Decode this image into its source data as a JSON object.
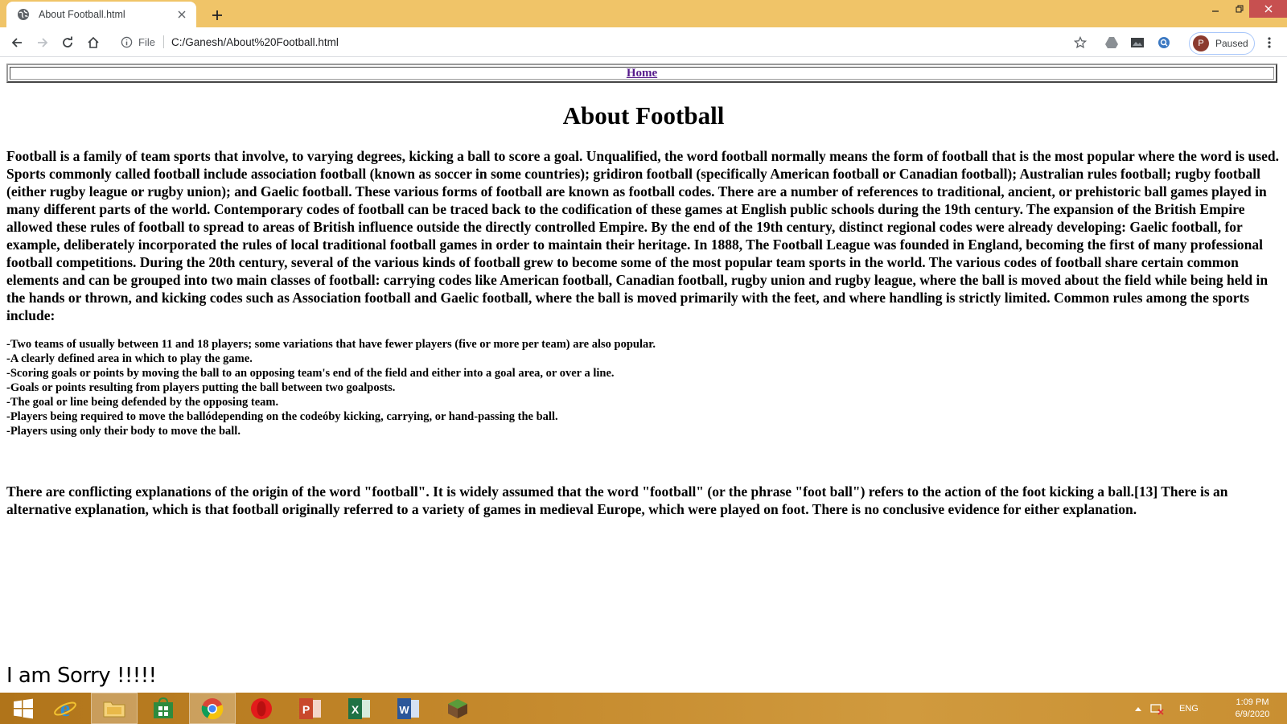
{
  "browser": {
    "tab_title": "About Football.html",
    "site_label": "File",
    "url": "C:/Ganesh/About%20Football.html",
    "profile_initial": "P",
    "profile_status": "Paused"
  },
  "page": {
    "nav_link": "Home",
    "title": "About Football",
    "paragraph1": "Football is a family of team sports that involve, to varying degrees, kicking a ball to score a goal. Unqualified, the word football normally means the form of football that is the most popular where the word is used. Sports commonly called football include association football (known as soccer in some countries); gridiron football (specifically American football or Canadian football); Australian rules football; rugby football (either rugby league or rugby union); and Gaelic football. These various forms of football are known as football codes. There are a number of references to traditional, ancient, or prehistoric ball games played in many different parts of the world. Contemporary codes of football can be traced back to the codification of these games at English public schools during the 19th century. The expansion of the British Empire allowed these rules of football to spread to areas of British influence outside the directly controlled Empire. By the end of the 19th century, distinct regional codes were already developing: Gaelic football, for example, deliberately incorporated the rules of local traditional football games in order to maintain their heritage. In 1888, The Football League was founded in England, becoming the first of many professional football competitions. During the 20th century, several of the various kinds of football grew to become some of the most popular team sports in the world. The various codes of football share certain common elements and can be grouped into two main classes of football: carrying codes like American football, Canadian football, rugby union and rugby league, where the ball is moved about the field while being held in the hands or thrown, and kicking codes such as Association football and Gaelic football, where the ball is moved primarily with the feet, and where handling is strictly limited. Common rules among the sports include:",
    "rules": [
      "-Two teams of usually between 11 and 18 players; some variations that have fewer players (five or more per team) are also popular.",
      "-A clearly defined area in which to play the game.",
      "-Scoring goals or points by moving the ball to an opposing team's end of the field and either into a goal area, or over a line.",
      "-Goals or points resulting from players putting the ball between two goalposts.",
      "-The goal or line being defended by the opposing team.",
      "-Players being required to move the ballódepending on the codeóby kicking, carrying, or hand-passing the ball.",
      "-Players using only their body to move the ball."
    ],
    "paragraph2": "There are conflicting explanations of the origin of the word \"football\". It is widely assumed that the word \"football\" (or the phrase \"foot ball\") refers to the action of the foot kicking a ball.[13] There is an alternative explanation, which is that football originally referred to a variety of games in medieval Europe, which were played on foot. There is no conclusive evidence for either explanation.",
    "footer_text": "I am Sorry !!!!!"
  },
  "taskbar": {
    "language": "ENG",
    "time": "1:09 PM",
    "date": "6/9/2020"
  },
  "colors": {
    "titlebar": "#f0c468",
    "link_visited": "#551a8b",
    "taskbar": "#c3872a"
  }
}
